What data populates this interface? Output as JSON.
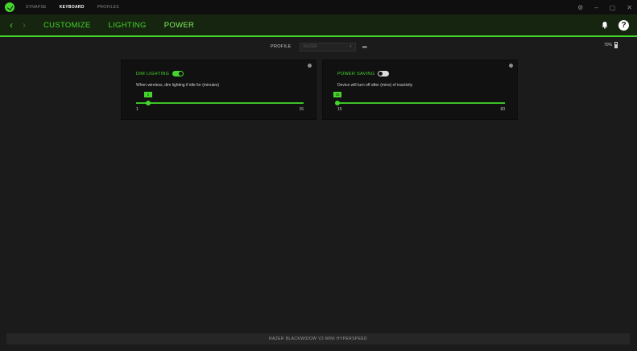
{
  "titlebar": {
    "tabs": [
      {
        "label": "SYNAPSE",
        "active": false
      },
      {
        "label": "KEYBOARD",
        "active": true
      },
      {
        "label": "PROFILES",
        "active": false
      }
    ],
    "controls": {
      "settings": "⚙",
      "minimize": "–",
      "maximize": "▢",
      "close": "✕"
    }
  },
  "nav": {
    "tabs": [
      {
        "label": "CUSTOMIZE",
        "active": false
      },
      {
        "label": "LIGHTING",
        "active": false
      },
      {
        "label": "POWER",
        "active": true
      }
    ],
    "help_label": "?"
  },
  "profile": {
    "label": "PROFILE",
    "selected": "RAZER",
    "more": "•••"
  },
  "battery": {
    "percent_label": "70%",
    "level": 0.7
  },
  "dim_lighting": {
    "title": "DIM LIGHTING",
    "toggle_on": true,
    "description": "When wireless, dim lighting if idle for (minutes)",
    "value": "2",
    "min": "1",
    "max": "15",
    "value_num": 2,
    "min_num": 1,
    "max_num": 15
  },
  "power_saving": {
    "title": "POWER SAVING",
    "toggle_on": false,
    "description": "Device will turn off after (mins) of inactivity",
    "value": "15",
    "min": "15",
    "max": "60",
    "value_num": 15,
    "min_num": 15,
    "max_num": 60
  },
  "footer": {
    "device_name": "RAZER BLACKWIDOW V3 MINI HYPERSPEED"
  },
  "colors": {
    "accent": "#44d62c",
    "background": "#1b1b1b",
    "card": "#111111"
  }
}
